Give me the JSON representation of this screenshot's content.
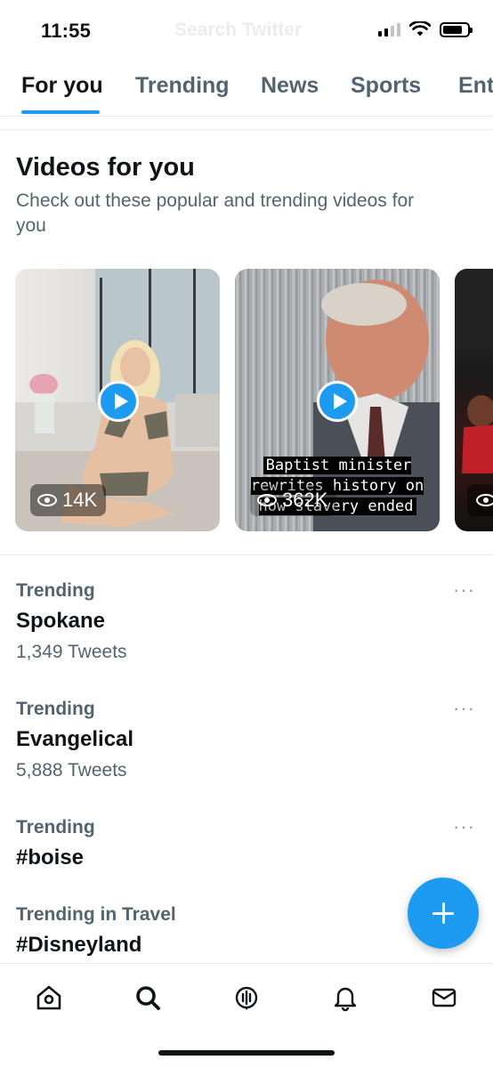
{
  "status_bar": {
    "time": "11:55",
    "search_hint": "Search Twitter"
  },
  "tabs": [
    {
      "label": "For you",
      "active": true
    },
    {
      "label": "Trending",
      "active": false
    },
    {
      "label": "News",
      "active": false
    },
    {
      "label": "Sports",
      "active": false
    },
    {
      "label": "Ent",
      "active": false
    }
  ],
  "videos": {
    "title": "Videos for you",
    "subtitle": "Check out these popular and trending videos for you",
    "items": [
      {
        "views": "14K",
        "caption": ""
      },
      {
        "views": "362K",
        "caption": "Baptist minister rewrites history on how slavery ended"
      },
      {
        "views": "",
        "caption": ""
      }
    ]
  },
  "trends": [
    {
      "context": "Trending",
      "name": "Spokane",
      "count": "1,349 Tweets",
      "more": "···"
    },
    {
      "context": "Trending",
      "name": "Evangelical",
      "count": "5,888 Tweets",
      "more": "···"
    },
    {
      "context": "Trending",
      "name": "#boise",
      "count": "",
      "more": "···"
    },
    {
      "context": "Trending in Travel",
      "name": "#Disneyland",
      "count": "",
      "more": ""
    }
  ],
  "fab": {
    "icon": "plus-icon",
    "color": "#1d9bf0"
  },
  "bottom_nav": [
    {
      "icon": "home-icon"
    },
    {
      "icon": "search-icon"
    },
    {
      "icon": "spaces-icon"
    },
    {
      "icon": "bell-icon"
    },
    {
      "icon": "mail-icon"
    }
  ],
  "colors": {
    "accent": "#1d9bf0",
    "text": "#0f1419",
    "secondary": "#536471"
  }
}
